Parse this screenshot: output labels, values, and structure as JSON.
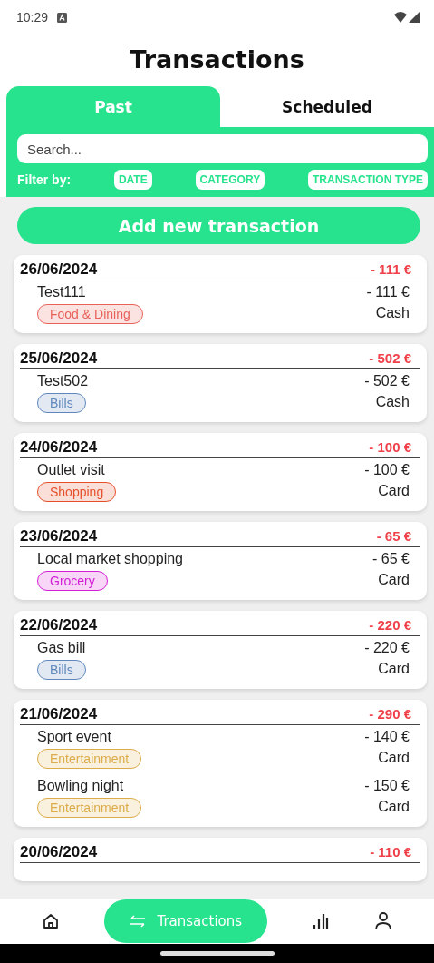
{
  "status_bar": {
    "time": "10:29"
  },
  "title": "Transactions",
  "tabs": [
    {
      "label": "Past",
      "selected": true
    },
    {
      "label": "Scheduled",
      "selected": false
    }
  ],
  "search": {
    "placeholder": "Search..."
  },
  "filter": {
    "label": "Filter by:",
    "chips": [
      "DATE",
      "CATEGORY",
      "TRANSACTION TYPE"
    ]
  },
  "add_button": "Add new transaction",
  "days": [
    {
      "date": "26/06/2024",
      "total": "- 111 €",
      "transactions": [
        {
          "name": "Test111",
          "amount": "- 111 €",
          "method": "Cash",
          "category": {
            "label": "Food & Dining",
            "color": "#e8625a"
          }
        }
      ]
    },
    {
      "date": "25/06/2024",
      "total": "- 502 €",
      "transactions": [
        {
          "name": "Test502",
          "amount": "- 502 €",
          "method": "Cash",
          "category": {
            "label": "Bills",
            "color": "#5f87bd"
          }
        }
      ]
    },
    {
      "date": "24/06/2024",
      "total": "- 100 €",
      "transactions": [
        {
          "name": "Outlet visit",
          "amount": "- 100 €",
          "method": "Card",
          "category": {
            "label": "Shopping",
            "color": "#e5502a"
          }
        }
      ]
    },
    {
      "date": "23/06/2024",
      "total": "- 65 €",
      "transactions": [
        {
          "name": "Local market shopping",
          "amount": "- 65 €",
          "method": "Card",
          "category": {
            "label": "Grocery",
            "color": "#d21ed6"
          }
        }
      ]
    },
    {
      "date": "22/06/2024",
      "total": "- 220 €",
      "transactions": [
        {
          "name": "Gas bill",
          "amount": "- 220 €",
          "method": "Card",
          "category": {
            "label": "Bills",
            "color": "#5f87bd"
          }
        }
      ]
    },
    {
      "date": "21/06/2024",
      "total": "- 290 €",
      "transactions": [
        {
          "name": "Sport event",
          "amount": "- 140 €",
          "method": "Card",
          "category": {
            "label": "Entertainment",
            "color": "#dcac4a"
          }
        },
        {
          "name": "Bowling night",
          "amount": "- 150 €",
          "method": "Card",
          "category": {
            "label": "Entertainment",
            "color": "#dcac4a"
          }
        }
      ]
    },
    {
      "date": "20/06/2024",
      "total": "- 110 €"
    }
  ],
  "nav": [
    {
      "kind": "home",
      "selected": false
    },
    {
      "kind": "transfer",
      "label": "Transactions",
      "selected": true
    },
    {
      "kind": "chart",
      "selected": false
    },
    {
      "kind": "profile",
      "selected": false
    }
  ]
}
